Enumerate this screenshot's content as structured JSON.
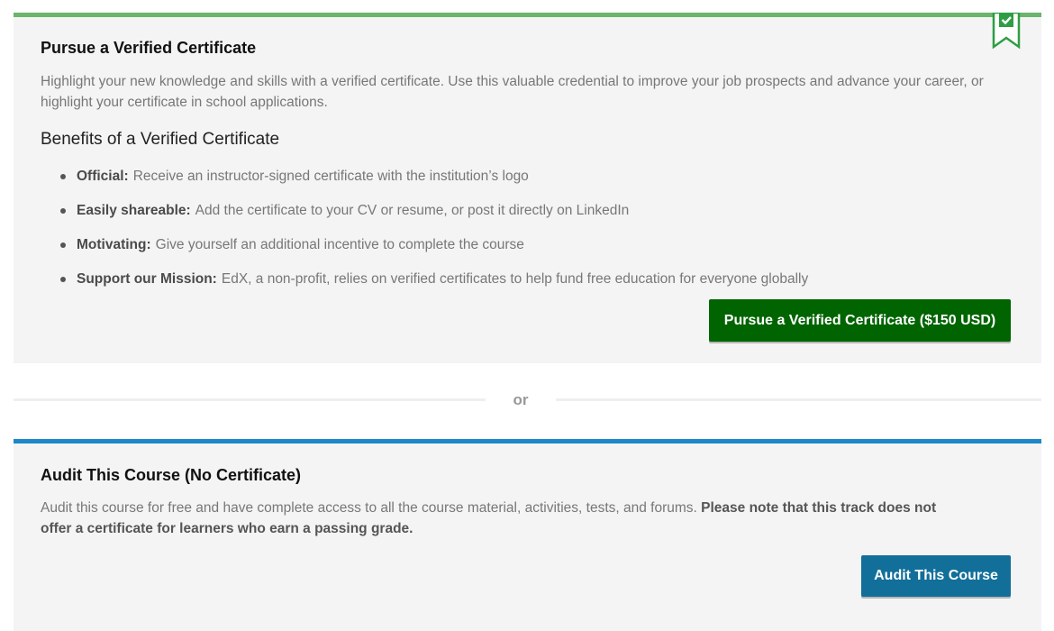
{
  "verified": {
    "title": "Pursue a Verified Certificate",
    "description": "Highlight your new knowledge and skills with a verified certificate. Use this valuable credential to improve your job prospects and advance your career, or highlight your certificate in school applications.",
    "benefits_heading": "Benefits of a Verified Certificate",
    "benefits": [
      {
        "term": "Official:",
        "text": "Receive an instructor-signed certificate with the institution’s logo"
      },
      {
        "term": "Easily shareable:",
        "text": "Add the certificate to your CV or resume, or post it directly on LinkedIn"
      },
      {
        "term": "Motivating:",
        "text": "Give yourself an additional incentive to complete the course"
      },
      {
        "term": "Support our Mission:",
        "text": "EdX, a non-profit, relies on verified certificates to help fund free education for everyone globally"
      }
    ],
    "button_label": "Pursue a Verified Certificate ($150 USD)",
    "accent_color": "#6cb36c",
    "button_color": "#006400",
    "ribbon_icon": "verified-ribbon-icon"
  },
  "divider": {
    "label": "or"
  },
  "audit": {
    "title": "Audit This Course (No Certificate)",
    "description": "Audit this course for free and have complete access to all the course material, activities, tests, and forums.",
    "description_emphasis": "Please note that this track does not offer a certificate for learners who earn a passing grade.",
    "button_label": "Audit This Course",
    "accent_color": "#1d88c9",
    "button_color": "#126f9a"
  }
}
